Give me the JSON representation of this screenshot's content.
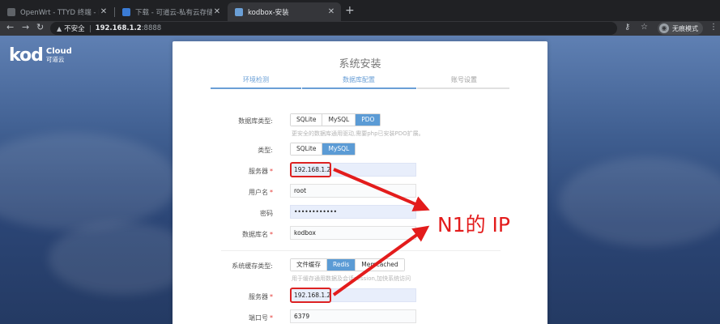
{
  "tabs": [
    {
      "title": "OpenWrt - TTYD 终端 - LuCI",
      "close": "✕"
    },
    {
      "title": "下载 - 可道云-私有云存储&协同",
      "close": "✕"
    },
    {
      "title": "kodbox-安装",
      "close": "✕"
    }
  ],
  "new_tab": "+",
  "address": {
    "security": "不安全",
    "host": "192.168.1.2",
    "port": ":8888"
  },
  "profile": {
    "label": "无痕模式"
  },
  "logo": {
    "main": "kod",
    "cloud": "Cloud",
    "sub": "可道云"
  },
  "install": {
    "title": "系统安装",
    "steps": [
      {
        "label": "环境检测",
        "active": true
      },
      {
        "label": "数据库配置",
        "active": true
      },
      {
        "label": "账号设置",
        "active": false
      }
    ]
  },
  "form": {
    "db_type": {
      "label": "数据库类型:",
      "options": [
        "SQLite",
        "MySQL",
        "PDO"
      ],
      "selected": "PDO",
      "hint": "更安全的数据库通用驱动,需要php已安装PDO扩展。"
    },
    "type": {
      "label": "类型:",
      "options": [
        "SQLite",
        "MySQL"
      ],
      "selected": "MySQL"
    },
    "server": {
      "label": "服务器",
      "value": "192.168.1.2"
    },
    "username": {
      "label": "用户名",
      "value": "root"
    },
    "password": {
      "label": "密码",
      "value": "••••••••••••"
    },
    "db_name": {
      "label": "数据库名",
      "value": "kodbox"
    },
    "cache_type": {
      "label": "系统缓存类型:",
      "options": [
        "文件缓存",
        "Redis",
        "Memcached"
      ],
      "selected": "Redis",
      "hint": "用于缓存通用数据及会话session,加快系统访问"
    },
    "cache_server": {
      "label": "服务器",
      "value": "192.168.1.2"
    },
    "port": {
      "label": "端口号",
      "value": "6379"
    },
    "required_mark": "*"
  },
  "annotation": {
    "text": "N1的 IP",
    "color": "#e31c1c"
  },
  "colors": {
    "accent": "#5b9bd5",
    "step_active": "#6a9fd6"
  }
}
